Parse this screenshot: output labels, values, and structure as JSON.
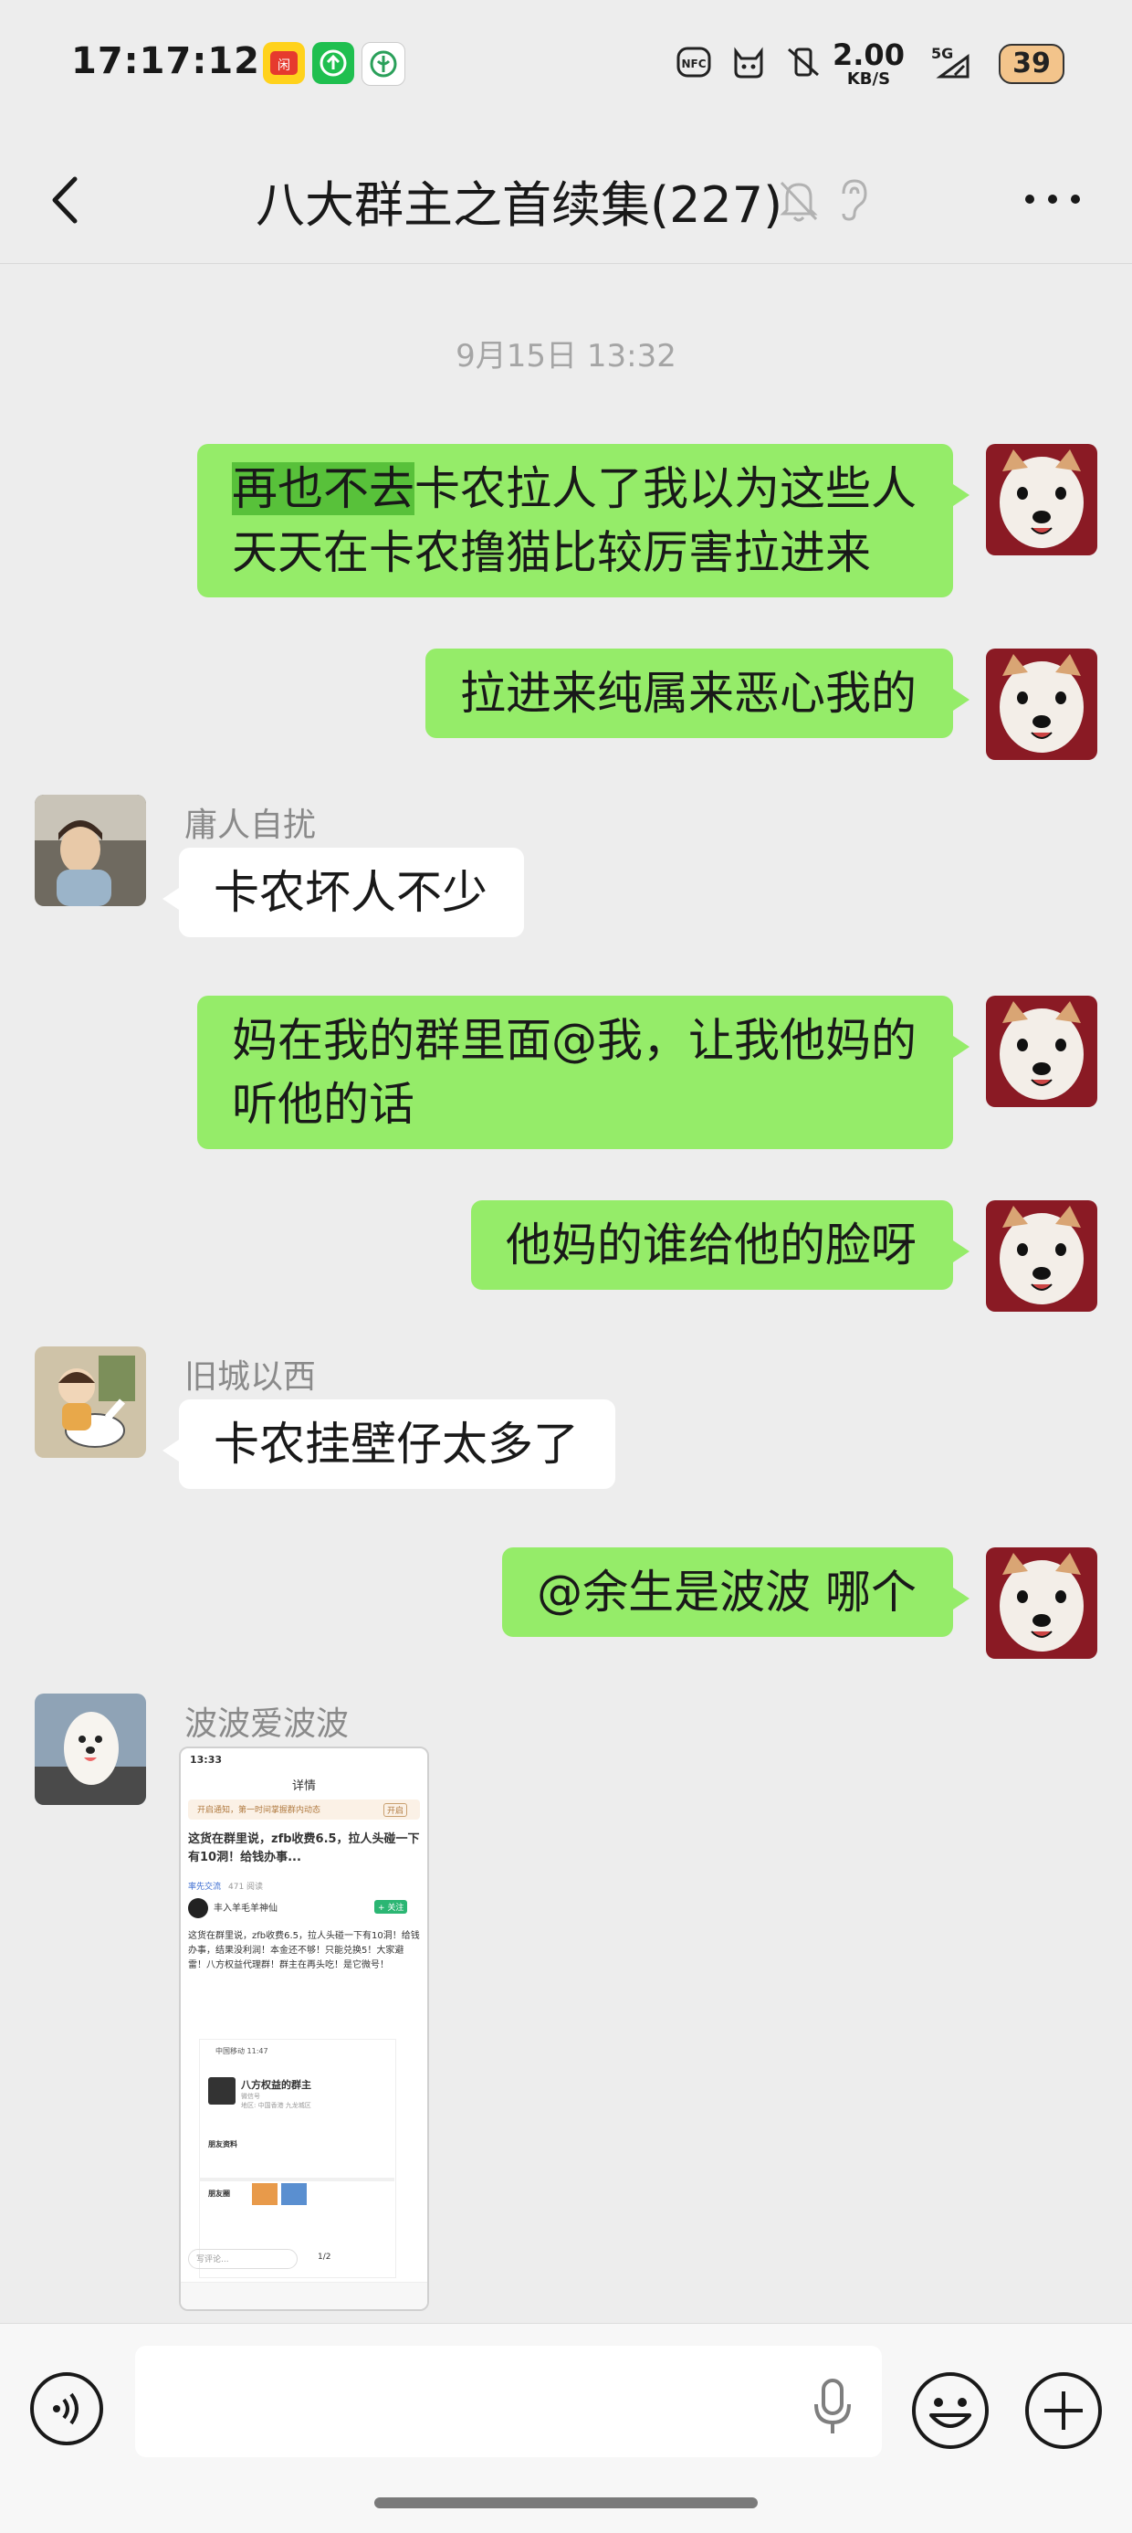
{
  "status_bar": {
    "time": "17:17:12",
    "net_speed_value": "2.00",
    "net_speed_unit": "KB/S",
    "network_type": "5G",
    "battery_level": "39",
    "app_icons": [
      "store-app-icon",
      "upload-app-icon",
      "eco-app-icon"
    ],
    "system_icons": [
      "nfc-icon",
      "cat-icon",
      "vibrate-off-icon",
      "signal-icon",
      "battery-icon"
    ]
  },
  "header": {
    "title": "八大群主之首续集(227)",
    "icons": [
      "back-icon",
      "mute-bell-icon",
      "ear-icon",
      "more-icon"
    ]
  },
  "chat": {
    "timestamp": "9月15日 13:32",
    "messages": [
      {
        "side": "me",
        "highlight": "再也不去",
        "line1_rest": "卡农拉人了我以为这些人",
        "line2": "天天在卡农撸猫比较厉害拉进来"
      },
      {
        "side": "me",
        "text": "拉进来纯属来恶心我的"
      },
      {
        "side": "other",
        "sender": "庸人自扰",
        "text": "卡农坏人不少"
      },
      {
        "side": "me",
        "line1": "妈在我的群里面@我，让我他妈的",
        "line2": "听他的话"
      },
      {
        "side": "me",
        "text": "他妈的谁给他的脸呀"
      },
      {
        "side": "other",
        "sender": "旧城以西",
        "text": "卡农挂壁仔太多了"
      },
      {
        "side": "me",
        "text": "@余生是波波  哪个"
      },
      {
        "side": "other",
        "sender": "波波爱波波",
        "type": "image"
      }
    ]
  },
  "image_message": {
    "status_time": "13:33",
    "page_title": "详情",
    "notice": "开启通知，第一时间掌握群内动态",
    "notice_btn": "开启",
    "headline": "这货在群里说，zfb收费6.5，拉人头碰一下有10洞！给钱办事...",
    "tag": "率先交流",
    "views": "471 阅读",
    "author": "丰入羊毛羊神仙",
    "follow_btn": "+ 关注",
    "body": "这货在群里说，zfb收费6.5，拉人头碰一下有10洞！给钱办事，结果没利润！本金还不够！只能兑换5！大家避雷！八方权益代理群！群主在再头吃！是它微号！",
    "inner_time": "中国移动 11:47",
    "inner_name": "八方权益的群主",
    "inner_sub1": "微信号",
    "inner_sub2": "地区: 中国香港 九龙城区",
    "inner_section1": "朋友资料",
    "inner_section2": "朋友圈",
    "comment_placeholder": "写评论...",
    "page_indicator": "1/2"
  },
  "input_bar": {
    "placeholder": "",
    "icons": [
      "voice-icon",
      "mic-icon",
      "emoji-icon",
      "plus-icon"
    ]
  },
  "colors": {
    "my_bubble": "#95ec69",
    "other_bubble": "#ffffff",
    "background": "#ededed",
    "highlight": "#58c13a"
  }
}
